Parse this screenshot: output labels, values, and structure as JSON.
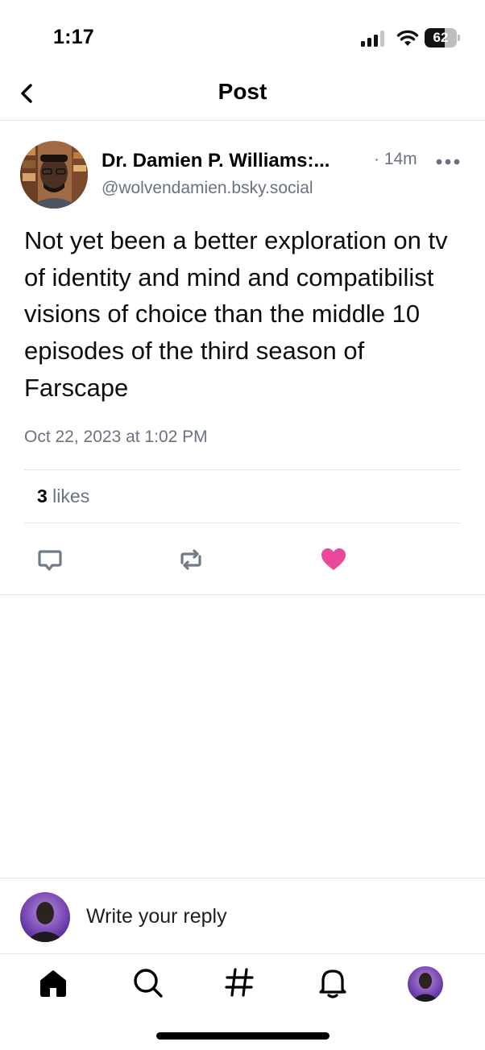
{
  "status_bar": {
    "time": "1:17",
    "battery_level": "62",
    "signal_icon": "cellular-signal-icon",
    "wifi_icon": "wifi-icon"
  },
  "header": {
    "title": "Post",
    "back_icon": "chevron-left-icon"
  },
  "post": {
    "author_name": "Dr. Damien P. Williams:...",
    "time_ago": "· 14m",
    "handle": "@wolvendamien.bsky.social",
    "text": "Not yet been a better exploration on tv of identity and mind and compatibilist visions of choice than the middle 10 episodes of the third season of Farscape",
    "date": "Oct 22, 2023 at 1:02 PM",
    "likes_count": "3",
    "likes_label": " likes",
    "liked": true,
    "actions": [
      "reply-icon",
      "repost-icon",
      "like-heart-icon"
    ]
  },
  "reply_bar": {
    "placeholder": "Write your reply"
  },
  "tab_bar": {
    "items": [
      "home-icon",
      "search-icon",
      "hashtag-icon",
      "notifications-bell-icon",
      "profile-avatar"
    ]
  },
  "colors": {
    "secondary_text": "#6a7282",
    "like_pink": "#ec4899",
    "action_gray": "#707b8a",
    "divider": "#e4e4e4"
  }
}
